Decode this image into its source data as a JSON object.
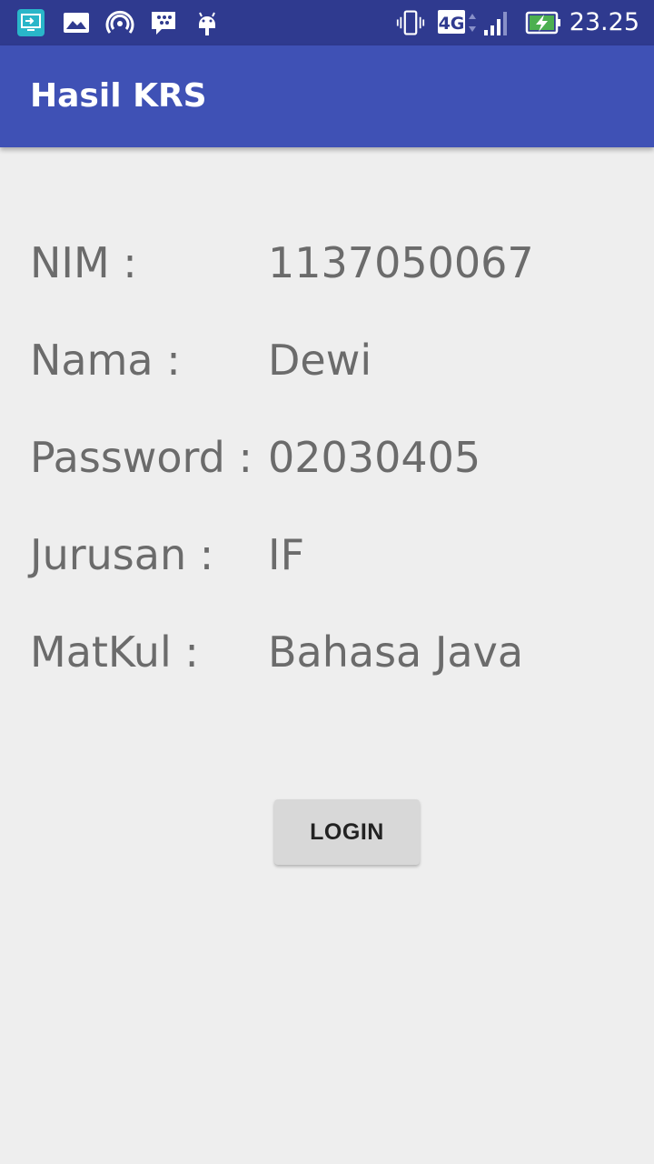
{
  "status_bar": {
    "time": "23.25",
    "network": "4G",
    "icons": [
      "screen-mirror-icon",
      "gallery-icon",
      "hotspot-icon",
      "bbm-icon",
      "android-icon",
      "vibrate-icon",
      "network-type-icon",
      "signal-icon",
      "battery-charging-icon"
    ]
  },
  "app_bar": {
    "title": "Hasil KRS"
  },
  "fields": [
    {
      "label": "NIM :",
      "value": "1137050067"
    },
    {
      "label": "Nama :",
      "value": "Dewi"
    },
    {
      "label": "Password :",
      "value": "02030405"
    },
    {
      "label": "Jurusan :",
      "value": "IF"
    },
    {
      "label": "MatKul :",
      "value": "Bahasa Java"
    }
  ],
  "button": {
    "label": "LOGIN"
  },
  "colors": {
    "status_bar": "#2f3a8f",
    "app_bar": "#3f51b5",
    "background": "#eeeeee",
    "text": "#6b6b6b",
    "button": "#d8d8d8"
  }
}
